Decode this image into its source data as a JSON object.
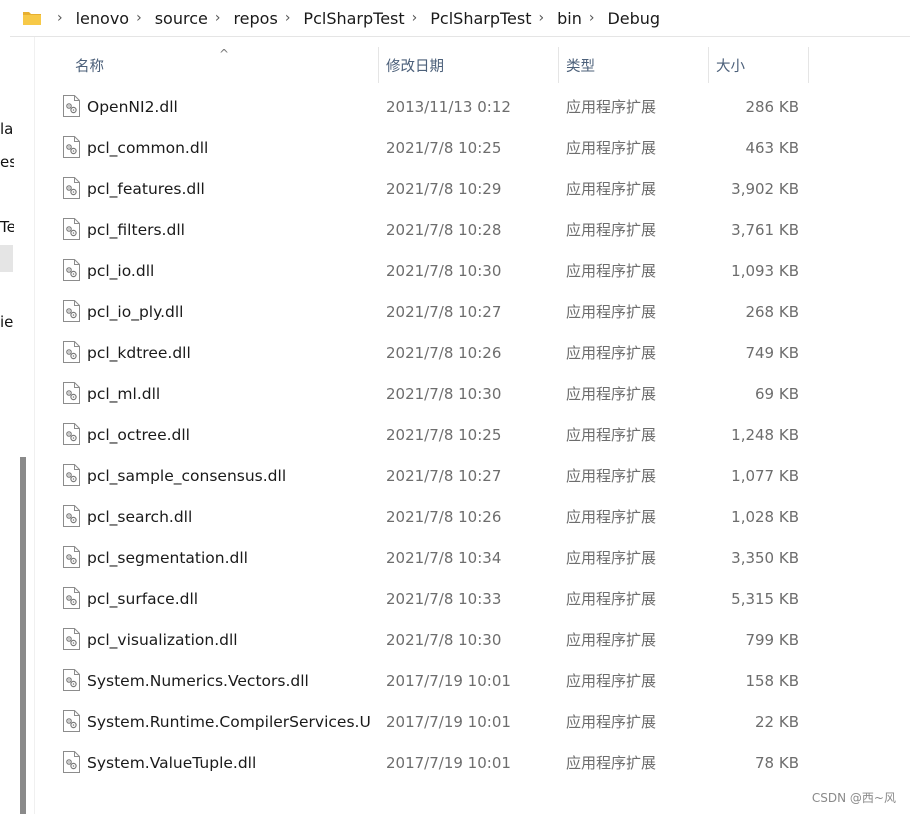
{
  "breadcrumb": [
    "lenovo",
    "source",
    "repos",
    "PclSharpTest",
    "PclSharpTest",
    "bin",
    "Debug"
  ],
  "nav_fragments": [
    "la",
    "es",
    "Te",
    "ie"
  ],
  "columns": {
    "name": "名称",
    "modified": "修改日期",
    "type": "类型",
    "size": "大小"
  },
  "sort_indicator": "^",
  "files": [
    {
      "name": "OpenNI2.dll",
      "modified": "2013/11/13 0:12",
      "type": "应用程序扩展",
      "size": "286 KB"
    },
    {
      "name": "pcl_common.dll",
      "modified": "2021/7/8 10:25",
      "type": "应用程序扩展",
      "size": "463 KB"
    },
    {
      "name": "pcl_features.dll",
      "modified": "2021/7/8 10:29",
      "type": "应用程序扩展",
      "size": "3,902 KB"
    },
    {
      "name": "pcl_filters.dll",
      "modified": "2021/7/8 10:28",
      "type": "应用程序扩展",
      "size": "3,761 KB"
    },
    {
      "name": "pcl_io.dll",
      "modified": "2021/7/8 10:30",
      "type": "应用程序扩展",
      "size": "1,093 KB"
    },
    {
      "name": "pcl_io_ply.dll",
      "modified": "2021/7/8 10:27",
      "type": "应用程序扩展",
      "size": "268 KB"
    },
    {
      "name": "pcl_kdtree.dll",
      "modified": "2021/7/8 10:26",
      "type": "应用程序扩展",
      "size": "749 KB"
    },
    {
      "name": "pcl_ml.dll",
      "modified": "2021/7/8 10:30",
      "type": "应用程序扩展",
      "size": "69 KB"
    },
    {
      "name": "pcl_octree.dll",
      "modified": "2021/7/8 10:25",
      "type": "应用程序扩展",
      "size": "1,248 KB"
    },
    {
      "name": "pcl_sample_consensus.dll",
      "modified": "2021/7/8 10:27",
      "type": "应用程序扩展",
      "size": "1,077 KB"
    },
    {
      "name": "pcl_search.dll",
      "modified": "2021/7/8 10:26",
      "type": "应用程序扩展",
      "size": "1,028 KB"
    },
    {
      "name": "pcl_segmentation.dll",
      "modified": "2021/7/8 10:34",
      "type": "应用程序扩展",
      "size": "3,350 KB"
    },
    {
      "name": "pcl_surface.dll",
      "modified": "2021/7/8 10:33",
      "type": "应用程序扩展",
      "size": "5,315 KB"
    },
    {
      "name": "pcl_visualization.dll",
      "modified": "2021/7/8 10:30",
      "type": "应用程序扩展",
      "size": "799 KB"
    },
    {
      "name": "System.Numerics.Vectors.dll",
      "modified": "2017/7/19 10:01",
      "type": "应用程序扩展",
      "size": "158 KB"
    },
    {
      "name": "System.Runtime.CompilerServices.U...",
      "modified": "2017/7/19 10:01",
      "type": "应用程序扩展",
      "size": "22 KB"
    },
    {
      "name": "System.ValueTuple.dll",
      "modified": "2017/7/19 10:01",
      "type": "应用程序扩展",
      "size": "78 KB"
    }
  ],
  "watermark": "CSDN @西~风",
  "icons": {
    "folder": "folder-icon",
    "file": "dll-file-icon",
    "chevron": "chevron-right-icon"
  },
  "colors": {
    "folder": "#f7c948",
    "header_text": "#4c607a",
    "meta_text": "#6d6d6d"
  }
}
